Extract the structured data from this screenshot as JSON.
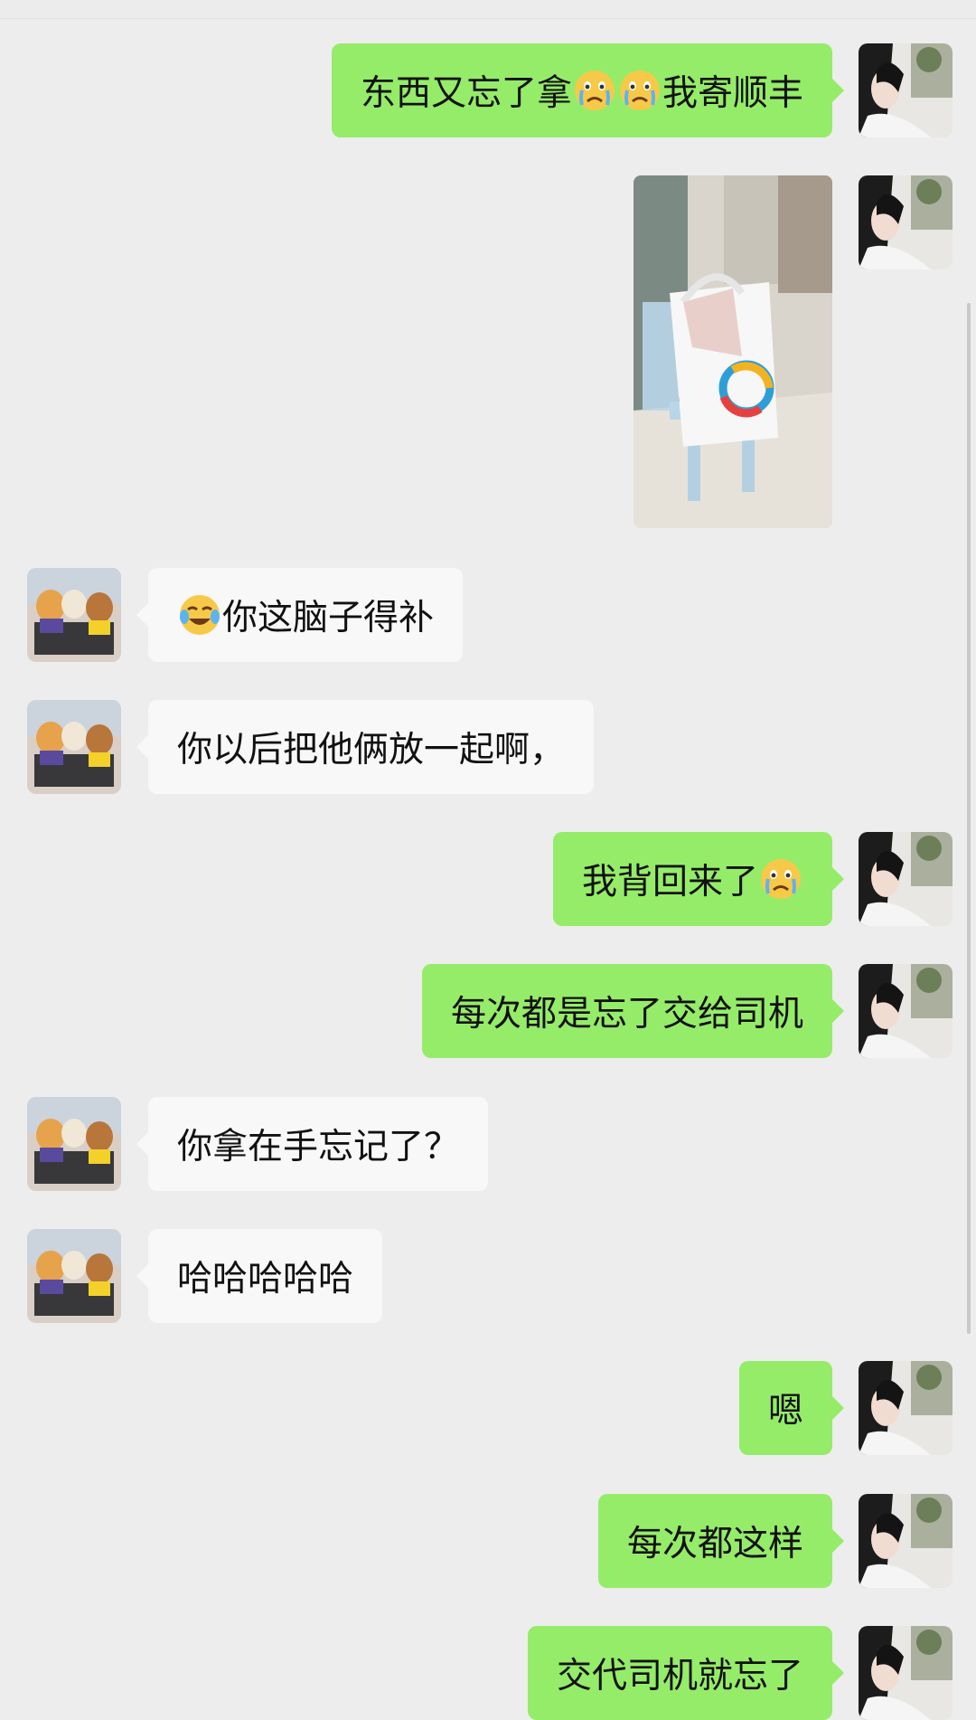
{
  "messages": [
    {
      "side": "self",
      "text_before": "东西又忘了拿",
      "emoji_count": 2,
      "text_after": "我寄顺丰",
      "emoji_name": "crying-emoji"
    },
    {
      "side": "self",
      "type": "image",
      "image_desc": "bag-on-stool-photo"
    },
    {
      "side": "other",
      "text_before": "",
      "emoji_count": 1,
      "text_after": "你这脑子得补",
      "emoji_name": "tears-of-joy-emoji"
    },
    {
      "side": "other",
      "text": "你以后把他俩放一起啊，"
    },
    {
      "side": "self",
      "text_before": "我背回来了",
      "emoji_count": 1,
      "text_after": "",
      "emoji_name": "crying-emoji"
    },
    {
      "side": "self",
      "text": "每次都是忘了交给司机"
    },
    {
      "side": "other",
      "text": "你拿在手忘记了？"
    },
    {
      "side": "other",
      "text": "哈哈哈哈哈"
    },
    {
      "side": "self",
      "text": "嗯"
    },
    {
      "side": "self",
      "text": "每次都这样"
    },
    {
      "side": "self",
      "text": "交代司机就忘了"
    }
  ],
  "colors": {
    "self_bubble": "#95ec69",
    "other_bubble": "#f8f8f8",
    "background": "#ededed"
  }
}
